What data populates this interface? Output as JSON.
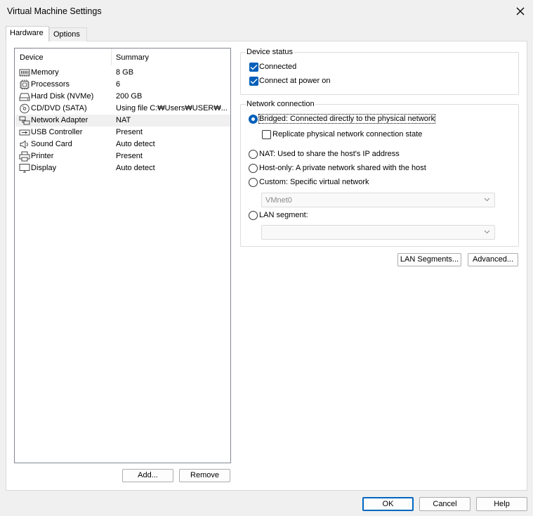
{
  "window": {
    "title": "Virtual Machine Settings"
  },
  "tabs": [
    {
      "label": "Hardware",
      "active": true
    },
    {
      "label": "Options",
      "active": false
    }
  ],
  "device_list": {
    "columns": [
      "Device",
      "Summary"
    ],
    "devices": [
      {
        "name": "Memory",
        "summary": "8 GB",
        "icon": "memory-icon"
      },
      {
        "name": "Processors",
        "summary": "6",
        "icon": "processor-icon"
      },
      {
        "name": "Hard Disk (NVMe)",
        "summary": "200 GB",
        "icon": "hard-disk-icon"
      },
      {
        "name": "CD/DVD (SATA)",
        "summary": "Using file C:₩Users₩USER₩...",
        "icon": "cd-dvd-icon"
      },
      {
        "name": "Network Adapter",
        "summary": "NAT",
        "icon": "network-adapter-icon",
        "selected": true
      },
      {
        "name": "USB Controller",
        "summary": "Present",
        "icon": "usb-icon"
      },
      {
        "name": "Sound Card",
        "summary": "Auto detect",
        "icon": "speaker-icon"
      },
      {
        "name": "Printer",
        "summary": "Present",
        "icon": "printer-icon"
      },
      {
        "name": "Display",
        "summary": "Auto detect",
        "icon": "display-icon"
      }
    ],
    "add_label": "Add...",
    "remove_label": "Remove"
  },
  "device_status": {
    "title": "Device status",
    "connected": {
      "label": "Connected",
      "checked": true
    },
    "connect_at_power_on": {
      "label": "Connect at power on",
      "checked": true
    }
  },
  "network_connection": {
    "title": "Network connection",
    "bridged": {
      "label": "Bridged: Connected directly to the physical network",
      "selected": true
    },
    "replicate": {
      "label": "Replicate physical network connection state",
      "checked": false
    },
    "nat": {
      "label": "NAT: Used to share the host's IP address",
      "selected": false
    },
    "host_only": {
      "label": "Host-only: A private network shared with the host",
      "selected": false
    },
    "custom": {
      "label": "Custom: Specific virtual network",
      "selected": false,
      "value": "VMnet0"
    },
    "lan_segment": {
      "label": "LAN segment:",
      "selected": false,
      "value": ""
    }
  },
  "lan_segments_label": "LAN Segments...",
  "advanced_label": "Advanced...",
  "footer": {
    "ok_label": "OK",
    "cancel_label": "Cancel",
    "help_label": "Help"
  },
  "colors": {
    "accent": "#005fb8",
    "default_button_border": "#0067c0"
  }
}
